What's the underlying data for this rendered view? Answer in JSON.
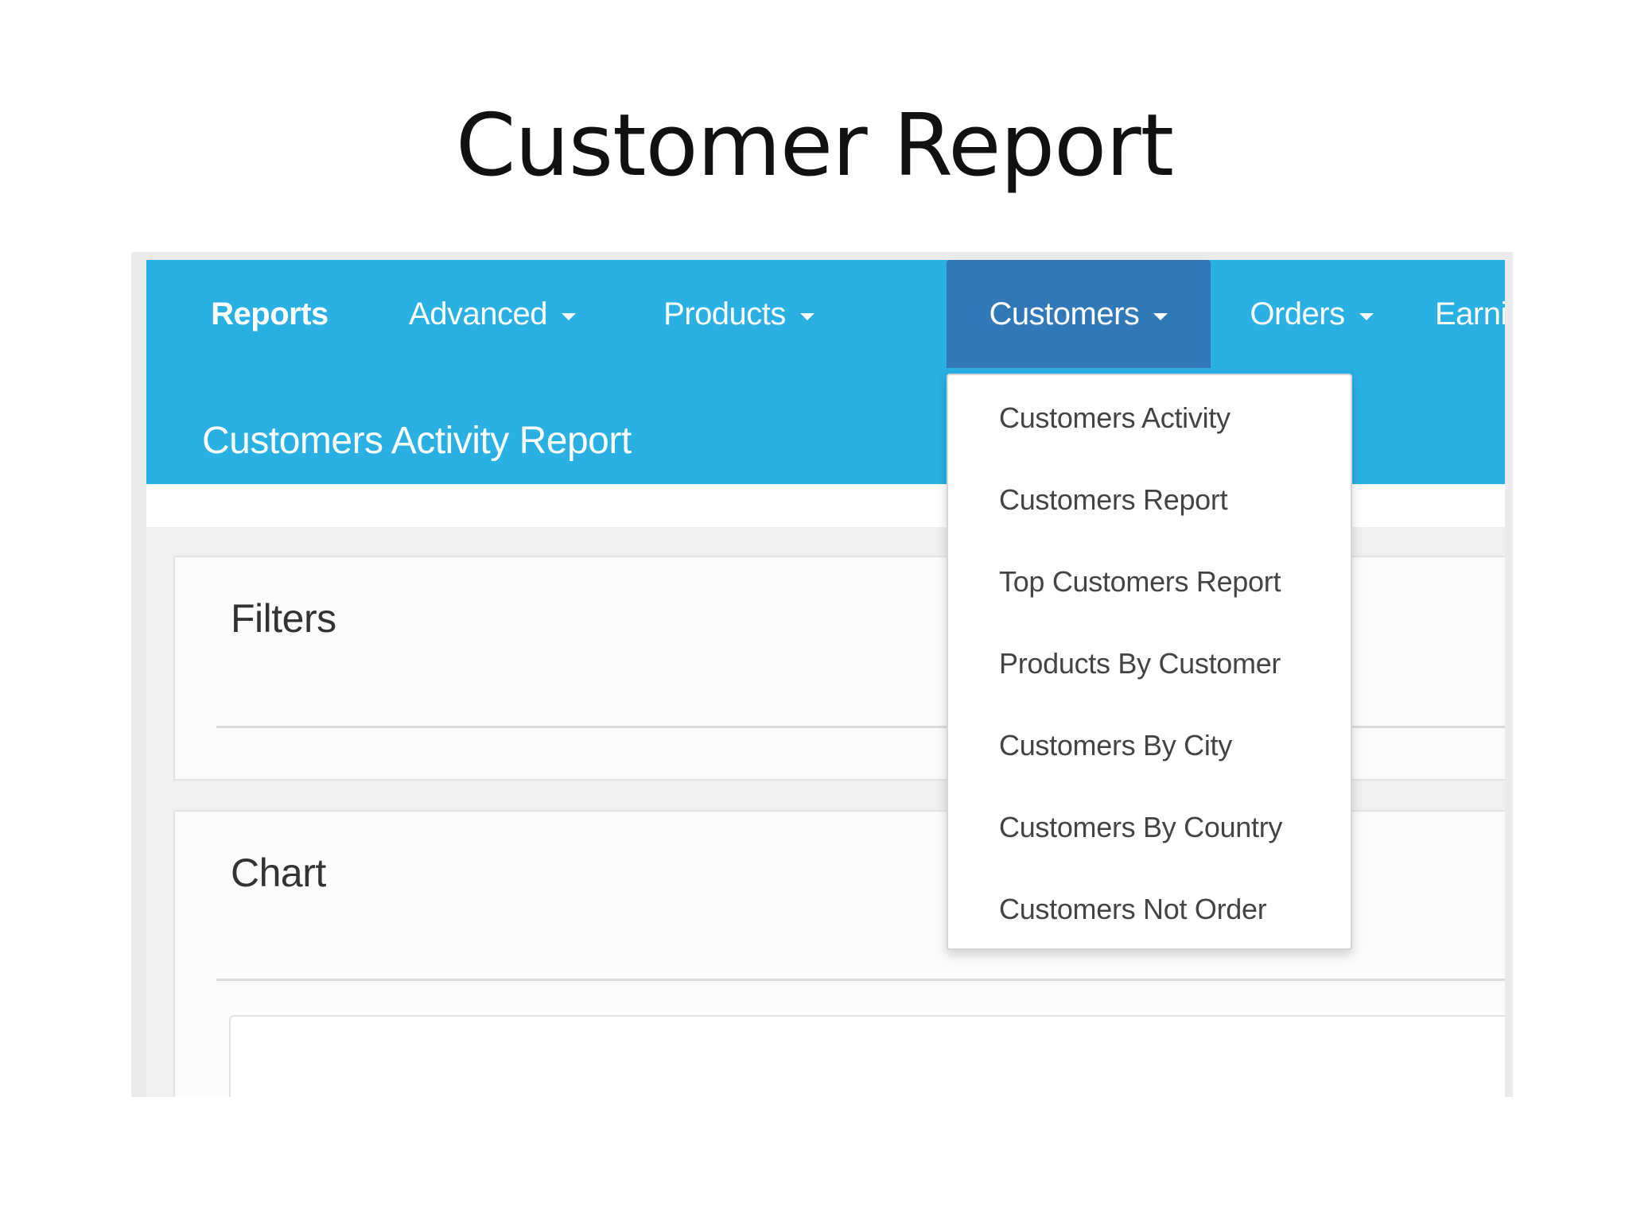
{
  "slide": {
    "title": "Customer Report"
  },
  "navbar": {
    "items": [
      {
        "label": "Reports",
        "has_caret": false,
        "active": false
      },
      {
        "label": "Advanced",
        "has_caret": true,
        "active": false
      },
      {
        "label": "Products",
        "has_caret": true,
        "active": false
      },
      {
        "label": "Customers",
        "has_caret": true,
        "active": true
      },
      {
        "label": "Orders",
        "has_caret": true,
        "active": false
      },
      {
        "label": "Earnin",
        "has_caret": false,
        "active": false
      }
    ],
    "page_heading": "Customers Activity Report",
    "accent_color": "#2ab0e3",
    "active_color": "#3178b8"
  },
  "dropdown": {
    "items": [
      "Customers Activity",
      "Customers Report",
      "Top Customers Report",
      "Products By Customer",
      "Customers By City",
      "Customers By Country",
      "Customers Not Order"
    ]
  },
  "panels": {
    "filters_title": "Filters",
    "chart_title": "Chart"
  }
}
